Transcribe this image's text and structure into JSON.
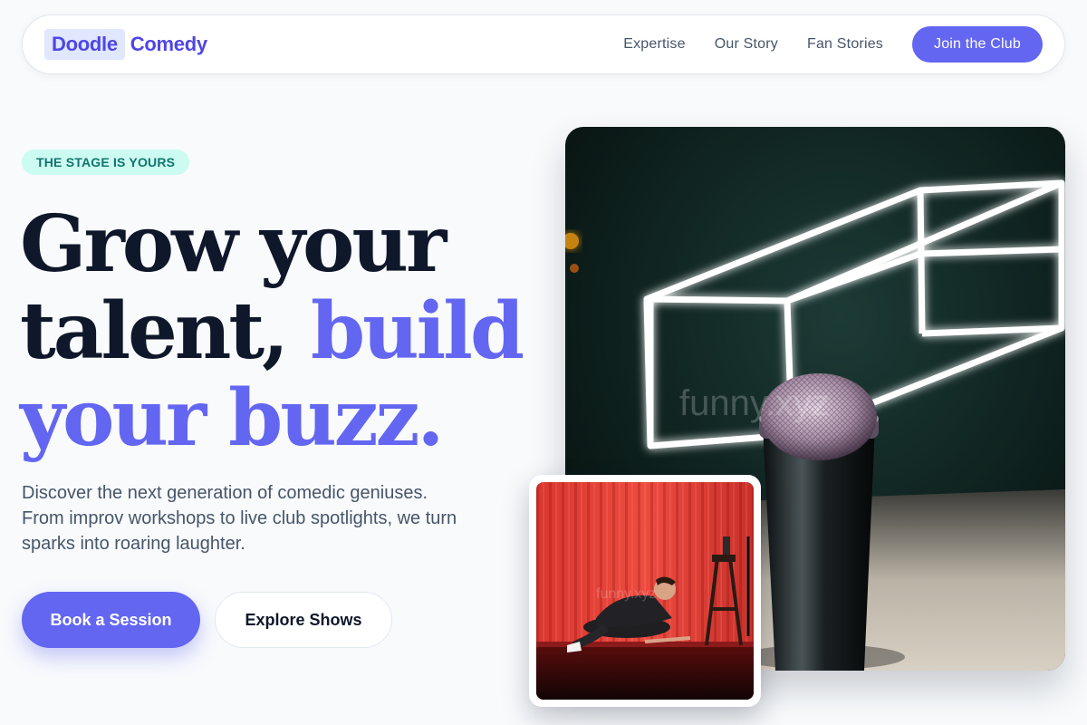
{
  "nav": {
    "logo_box": "Doodle",
    "logo_text": "Comedy",
    "links": [
      "Expertise",
      "Our Story",
      "Fan Stories"
    ],
    "cta": "Join the Club"
  },
  "hero": {
    "badge": "THE STAGE IS YOURS",
    "headline_line1": "Grow your",
    "headline_line2_plain": "talent, ",
    "headline_line2_accent": "build",
    "headline_line3_accent": "your buzz.",
    "subtitle": "Discover the next generation of comedic geniuses. From improv workshops to live club spotlights, we turn sparks into roaring laughter.",
    "primary_button": "Book a Session",
    "secondary_button": "Explore Shows"
  },
  "images": {
    "main_watermark": "funny.xyz",
    "inset_watermark": "funny.xyz"
  },
  "colors": {
    "accent": "#6366f1",
    "logo": "#4f46e5",
    "badge_bg": "#ccfbf1",
    "badge_text": "#0f766e",
    "text_dark": "#0f172a",
    "text_muted": "#475569"
  }
}
